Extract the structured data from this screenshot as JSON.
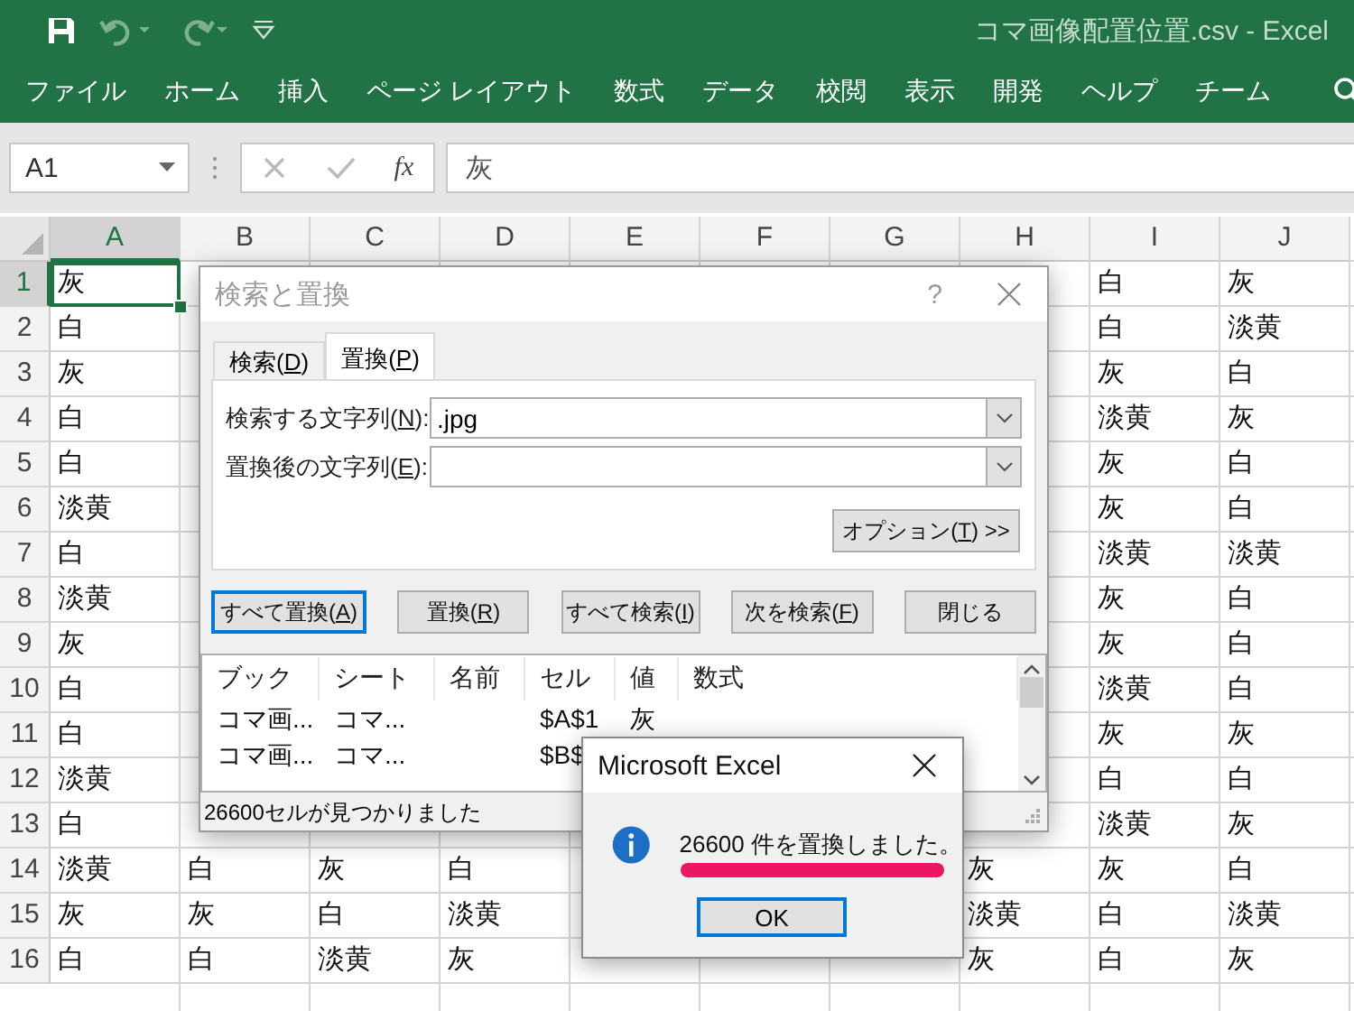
{
  "window": {
    "title": "コマ画像配置位置.csv  -  Excel"
  },
  "ribbon_tabs": [
    "ファイル",
    "ホーム",
    "挿入",
    "ページ レイアウト",
    "数式",
    "データ",
    "校閲",
    "表示",
    "開発",
    "ヘルプ",
    "チーム"
  ],
  "formula_bar": {
    "name_box": "A1",
    "function_label": "fx",
    "formula": "灰"
  },
  "sheet": {
    "columns": [
      {
        "label": "A",
        "selected": true
      },
      {
        "label": "B",
        "selected": false
      },
      {
        "label": "C",
        "selected": false
      },
      {
        "label": "D",
        "selected": false
      },
      {
        "label": "E",
        "selected": false
      },
      {
        "label": "F",
        "selected": false
      },
      {
        "label": "G",
        "selected": false
      },
      {
        "label": "H",
        "selected": false
      },
      {
        "label": "I",
        "selected": false
      },
      {
        "label": "J",
        "selected": false
      }
    ],
    "rows": [
      {
        "number": "1",
        "selected": true,
        "cells": [
          "灰",
          null,
          null,
          null,
          null,
          null,
          null,
          null,
          "白",
          "灰"
        ]
      },
      {
        "number": "2",
        "selected": false,
        "cells": [
          "白",
          null,
          null,
          null,
          null,
          null,
          null,
          null,
          "白",
          "淡黄"
        ]
      },
      {
        "number": "3",
        "selected": false,
        "cells": [
          "灰",
          null,
          null,
          null,
          null,
          null,
          null,
          null,
          "灰",
          "白"
        ]
      },
      {
        "number": "4",
        "selected": false,
        "cells": [
          "白",
          null,
          null,
          null,
          null,
          null,
          null,
          null,
          "淡黄",
          "灰"
        ]
      },
      {
        "number": "5",
        "selected": false,
        "cells": [
          "白",
          null,
          null,
          null,
          null,
          null,
          null,
          null,
          "灰",
          "白"
        ]
      },
      {
        "number": "6",
        "selected": false,
        "cells": [
          "淡黄",
          null,
          null,
          null,
          null,
          null,
          null,
          null,
          "灰",
          "白"
        ]
      },
      {
        "number": "7",
        "selected": false,
        "cells": [
          "白",
          null,
          null,
          null,
          null,
          null,
          null,
          null,
          "淡黄",
          "淡黄"
        ]
      },
      {
        "number": "8",
        "selected": false,
        "cells": [
          "淡黄",
          null,
          null,
          null,
          null,
          null,
          null,
          null,
          "灰",
          "白"
        ]
      },
      {
        "number": "9",
        "selected": false,
        "cells": [
          "灰",
          null,
          null,
          null,
          null,
          null,
          null,
          null,
          "灰",
          "白"
        ]
      },
      {
        "number": "10",
        "selected": false,
        "cells": [
          "白",
          null,
          null,
          null,
          null,
          null,
          null,
          null,
          "淡黄",
          "白"
        ]
      },
      {
        "number": "11",
        "selected": false,
        "cells": [
          "白",
          null,
          null,
          null,
          null,
          null,
          null,
          null,
          "灰",
          "灰"
        ]
      },
      {
        "number": "12",
        "selected": false,
        "cells": [
          "淡黄",
          null,
          null,
          null,
          null,
          null,
          null,
          null,
          "白",
          "白"
        ]
      },
      {
        "number": "13",
        "selected": false,
        "cells": [
          "白",
          null,
          null,
          null,
          null,
          null,
          null,
          null,
          "淡黄",
          "灰"
        ]
      },
      {
        "number": "14",
        "selected": false,
        "cells": [
          "淡黄",
          "白",
          "灰",
          "白",
          null,
          null,
          null,
          "灰",
          "灰",
          "白"
        ]
      },
      {
        "number": "15",
        "selected": false,
        "cells": [
          "灰",
          "灰",
          "白",
          "淡黄",
          null,
          null,
          null,
          "淡黄",
          "白",
          "淡黄"
        ]
      },
      {
        "number": "16",
        "selected": false,
        "cells": [
          "白",
          "白",
          "淡黄",
          "灰",
          null,
          null,
          null,
          "灰",
          "白",
          "灰"
        ]
      }
    ]
  },
  "find_dialog": {
    "title": "検索と置換",
    "help": "?",
    "tabs": [
      {
        "label": {
          "pre": "検索(",
          "key": "D",
          "post": ")"
        },
        "selected": false
      },
      {
        "label": {
          "pre": "置換(",
          "key": "P",
          "post": ")"
        },
        "selected": true
      }
    ],
    "fields": [
      {
        "label": {
          "pre": "検索する文字列(",
          "key": "N",
          "post": "):"
        },
        "value": ".jpg"
      },
      {
        "label": {
          "pre": "置換後の文字列(",
          "key": "E",
          "post": "):"
        }
      }
    ],
    "options_button": {
      "pre": "オプション(",
      "key": "T",
      "post": ") >>"
    },
    "buttons": [
      {
        "label": {
          "pre": "すべて置換(",
          "key": "A",
          "post": ")"
        },
        "default": true
      },
      {
        "label": {
          "pre": "置換(",
          "key": "R",
          "post": ")"
        },
        "default": false
      },
      {
        "label": {
          "pre": "すべて検索(",
          "key": "I",
          "post": ")"
        },
        "default": false
      },
      {
        "label": {
          "pre": "次を検索(",
          "key": "F",
          "post": ")"
        },
        "default": false
      },
      {
        "label": {
          "pre": "閉じる"
        },
        "default": false
      }
    ],
    "results": {
      "columns": [
        "ブック",
        "シート",
        "名前",
        "セル",
        "値",
        "数式"
      ],
      "rows": [
        [
          "コマ画...",
          "コマ...",
          null,
          "$A$1",
          "灰",
          null
        ],
        [
          "コマ画...",
          "コマ...",
          null,
          "$B$",
          null,
          null
        ]
      ]
    },
    "status": "26600セルが見つかりました"
  },
  "message_box": {
    "title": "Microsoft Excel",
    "message": "26600 件を置換しました。",
    "button": "OK"
  }
}
